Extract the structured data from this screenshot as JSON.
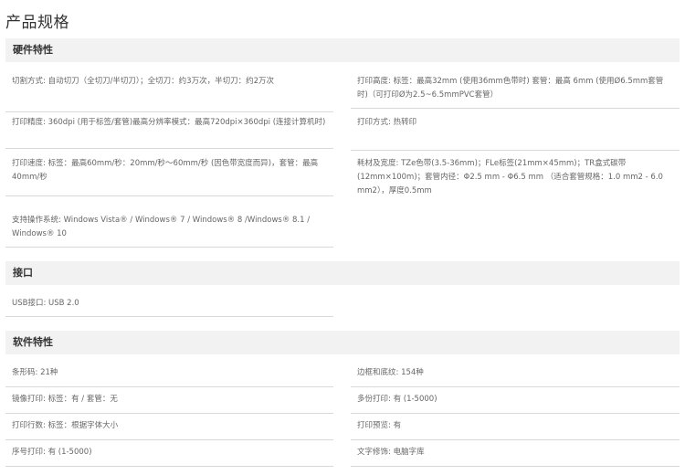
{
  "page_title": "产品规格",
  "sections": {
    "hardware": {
      "title": "硬件特性",
      "left": [
        "切割方式: 自动切刀（全切刀/半切刀）；全切刀：约3万次，半切刀：约2万次",
        "打印精度: 360dpi (用于标签/套管)最高分辨率模式：最高720dpi×360dpi (连接计算机时)",
        "打印速度: 标签：最高60mm/秒：20mm/秒～60mm/秒 (因色带宽度而异)，套管：最高40mm/秒",
        "支持操作系统: Windows Vista® / Windows® 7 / Windows® 8 /Windows® 8.1 / Windows® 10"
      ],
      "right": [
        "打印高度: 标签：最高32mm (使用36mm色带时) 套管：最高 6mm (使用Ø6.5mm套管时)（可打印Ø为2.5~6.5mmPVC套管）",
        "打印方式: 热转印",
        "耗材及宽度: TZe色带(3.5-36mm)；FLe标签(21mm×45mm)；TR盒式碳带(12mm×100m)；套管内径：Φ2.5 mm - Φ6.5 mm （适合套管规格：1.0 mm2 - 6.0 mm2），厚度0.5mm"
      ]
    },
    "interface": {
      "title": "接口",
      "left": [
        "USB接口: USB 2.0"
      ]
    },
    "software": {
      "title": "软件特性",
      "left": [
        "条形码: 21种",
        "镜像打印: 标签：有 / 套管：无",
        "打印行数: 标签：根据字体大小",
        "序号打印: 有 (1-5000)"
      ],
      "right": [
        "边框和底纹: 154种",
        "多份打印: 有 (1-5000)",
        "打印预览: 有",
        "文字修饰: 电脑字库"
      ]
    }
  }
}
